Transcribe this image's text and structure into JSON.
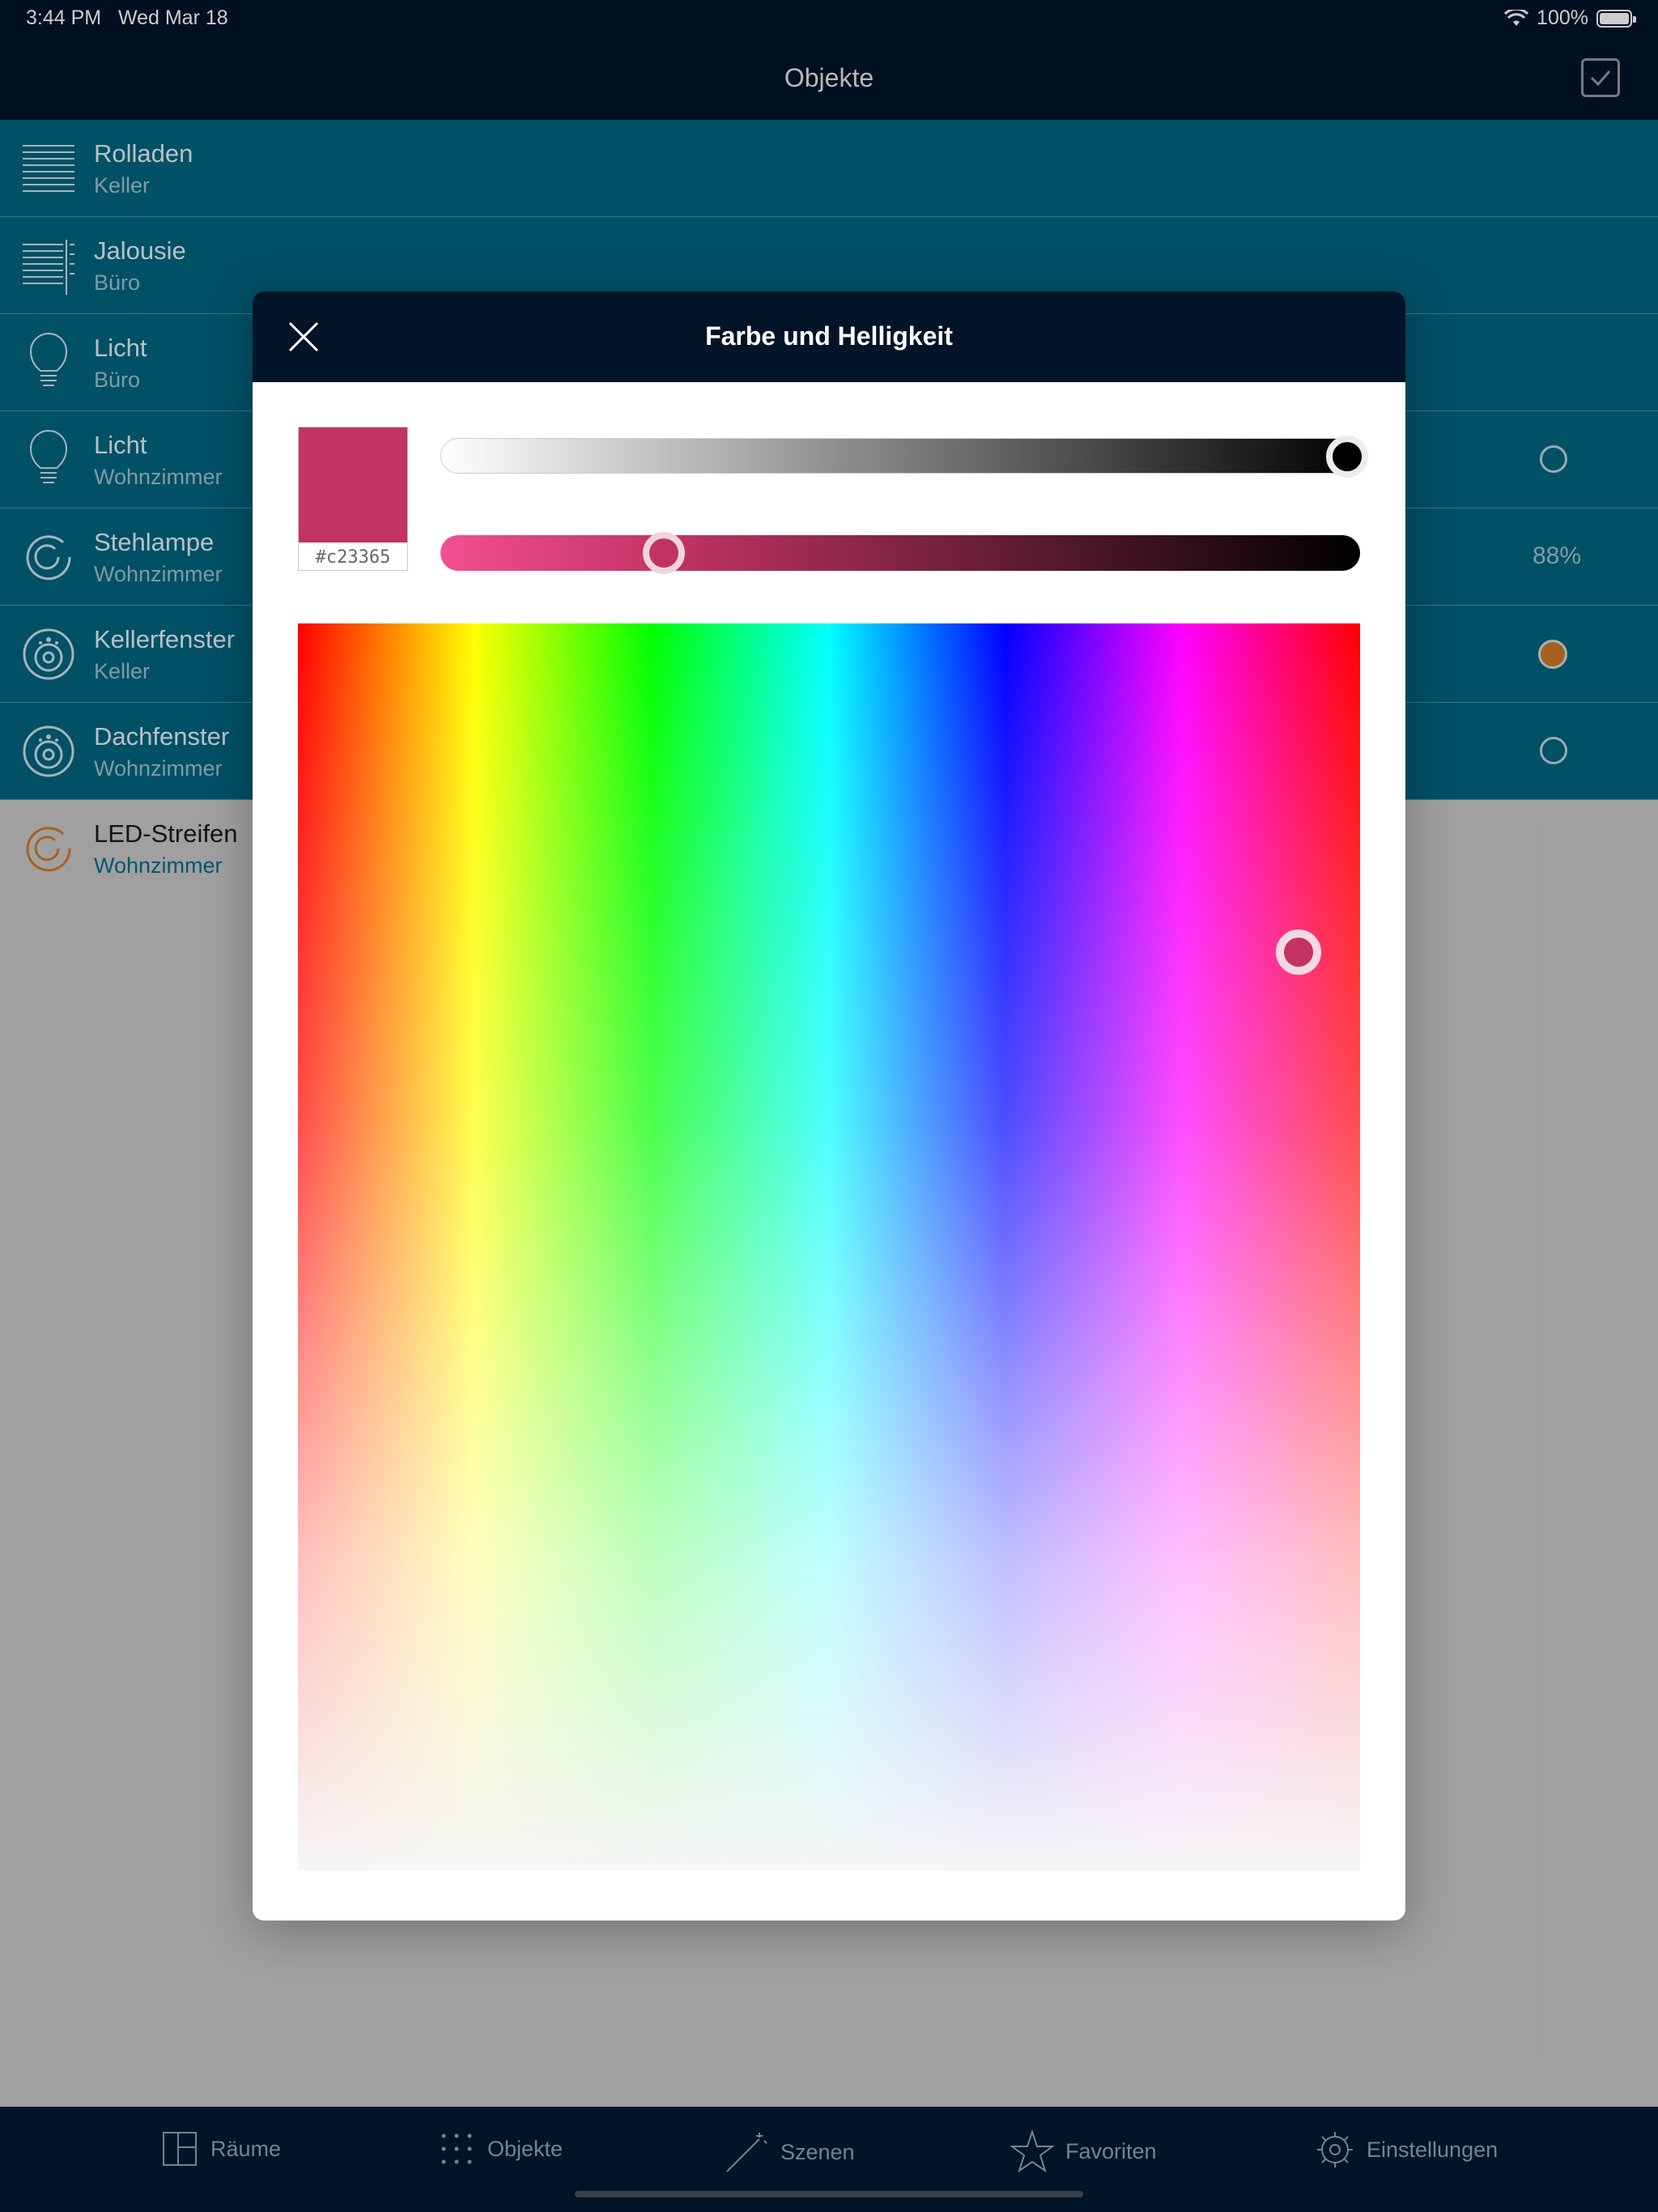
{
  "status": {
    "time": "3:44 PM",
    "date": "Wed Mar 18",
    "battery": "100%"
  },
  "nav": {
    "title": "Objekte"
  },
  "items": [
    {
      "name": "Rolladen",
      "room": "Keller",
      "icon": "roller-shutter-icon",
      "state": ""
    },
    {
      "name": "Jalousie",
      "room": "Büro",
      "icon": "blinds-icon",
      "state": ""
    },
    {
      "name": "Licht",
      "room": "Büro",
      "icon": "bulb-icon",
      "state": ""
    },
    {
      "name": "Licht",
      "room": "Wohnzimmer",
      "icon": "bulb-icon",
      "state": "off"
    },
    {
      "name": "Stehlampe",
      "room": "Wohnzimmer",
      "icon": "dimmer-icon",
      "state": "88%"
    },
    {
      "name": "Kellerfenster",
      "room": "Keller",
      "icon": "window-contact-icon",
      "state": "on"
    },
    {
      "name": "Dachfenster",
      "room": "Wohnzimmer",
      "icon": "window-contact-icon",
      "state": "off"
    },
    {
      "name": "LED-Streifen",
      "room": "Wohnzimmer",
      "icon": "led-strip-icon",
      "state": ""
    }
  ],
  "modal": {
    "title": "Farbe und Helligkeit",
    "hex": "#c23365",
    "color": "#c23365",
    "brightness_level": 1.0,
    "shade_level": 0.25
  },
  "tabs": [
    {
      "label": "Räume",
      "icon": "rooms-icon"
    },
    {
      "label": "Objekte",
      "icon": "objects-grid-icon"
    },
    {
      "label": "Szenen",
      "icon": "magic-wand-icon"
    },
    {
      "label": "Favoriten",
      "icon": "star-icon"
    },
    {
      "label": "Einstellungen",
      "icon": "gear-icon"
    }
  ]
}
